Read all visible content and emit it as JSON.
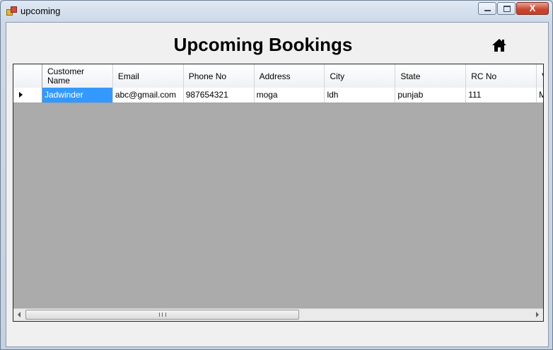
{
  "window": {
    "title": "upcoming",
    "close_glyph": "X"
  },
  "page": {
    "heading": "Upcoming Bookings",
    "home_icon": "home-icon"
  },
  "grid": {
    "columns": [
      "Customer Name",
      "Email",
      "Phone No",
      "Address",
      "City",
      "State",
      "RC No",
      "V"
    ],
    "rows": [
      [
        "Jadwinder",
        "abc@gmail.com",
        "987654321",
        "moga",
        "ldh",
        "punjab",
        "111",
        "M"
      ]
    ],
    "scroll_grip": "III"
  },
  "colors": {
    "selection": "#3399ff",
    "grid_background": "#ababab"
  }
}
